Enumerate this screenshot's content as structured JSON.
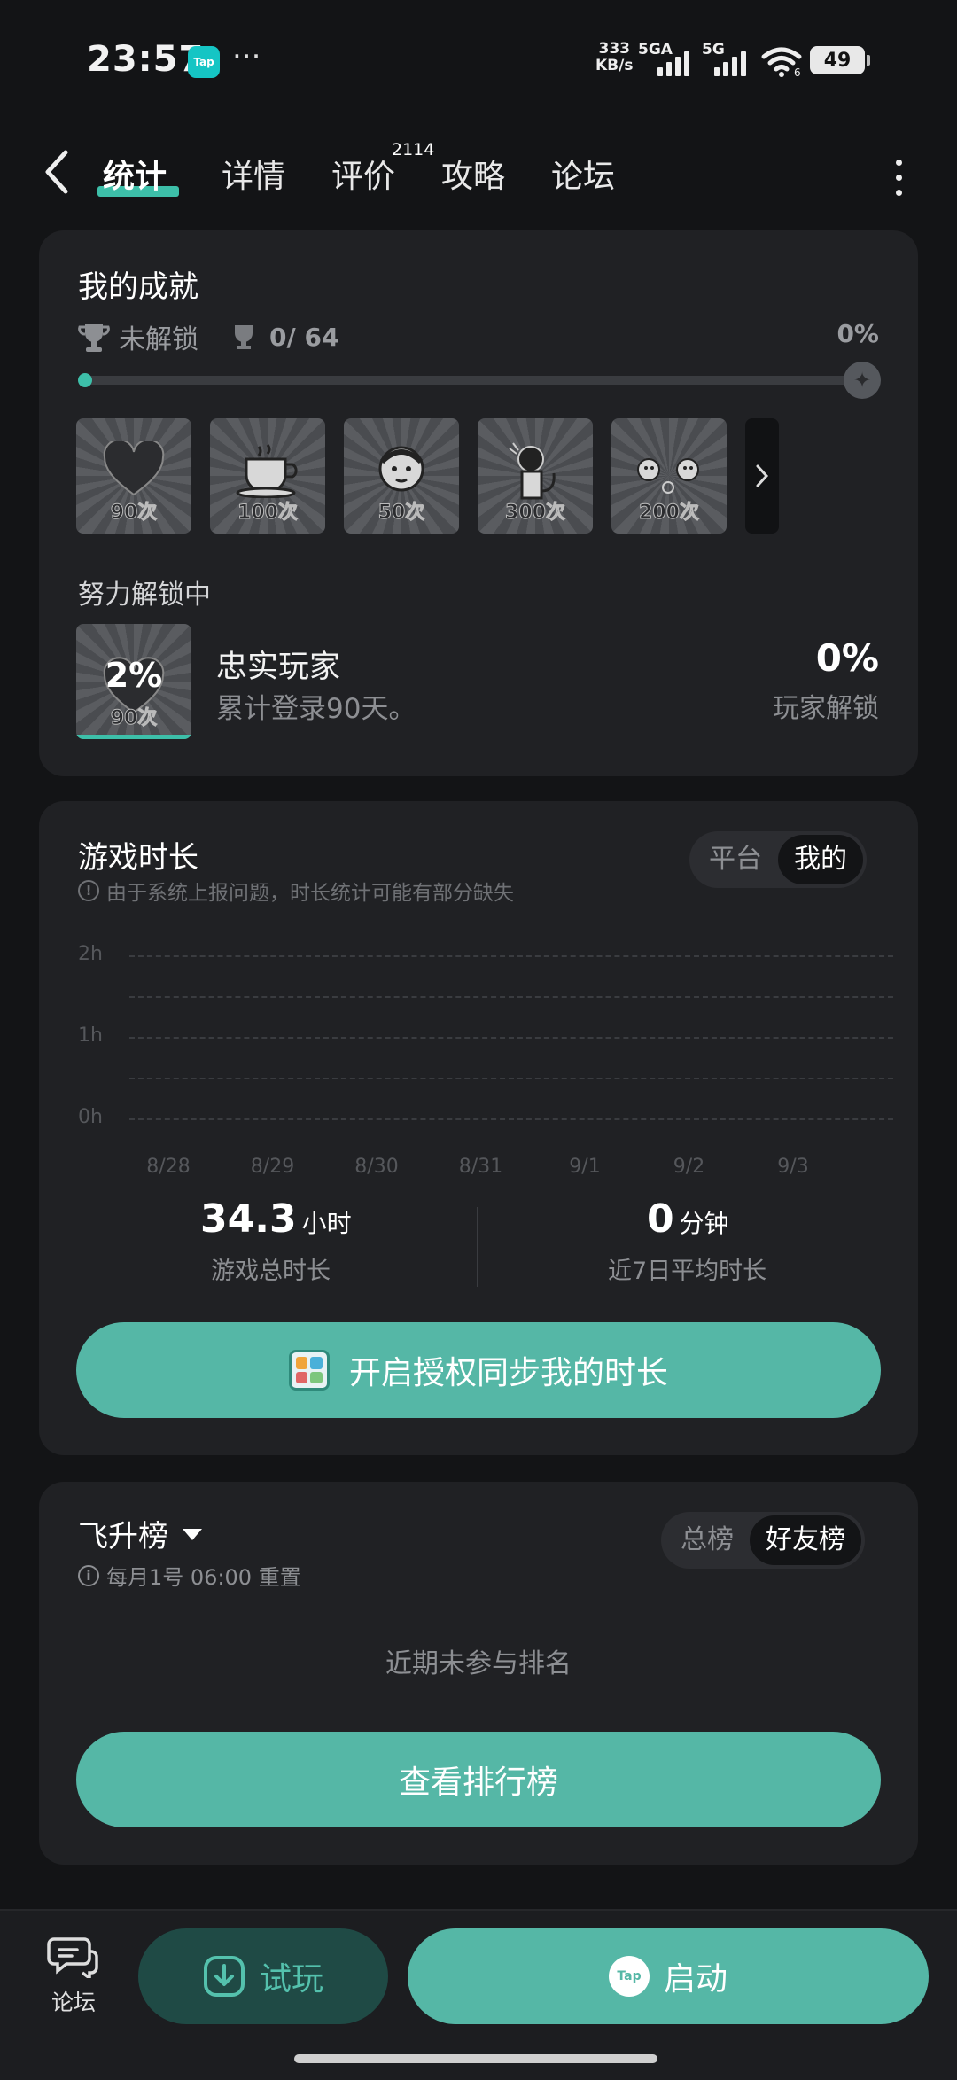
{
  "status": {
    "time": "23:57",
    "tap_badge": "Tap",
    "more_dots": "···",
    "net_speed_value": "333",
    "net_speed_unit": "KB/s",
    "sim1": "5GA",
    "sim2": "5G",
    "wifi_sub": "6",
    "battery": "49"
  },
  "nav": {
    "tabs": [
      {
        "label": "统计"
      },
      {
        "label": "详情"
      },
      {
        "label": "评价"
      },
      {
        "label": "攻略"
      },
      {
        "label": "论坛"
      }
    ],
    "review_count": "2114"
  },
  "achievements": {
    "title": "我的成就",
    "locked_label": "未解锁",
    "trophy_count": "0/ 64",
    "percent": "0%",
    "badges": [
      {
        "label": "90次",
        "icon": "heart-icon"
      },
      {
        "label": "100次",
        "icon": "coffee-icon"
      },
      {
        "label": "50次",
        "icon": "face-icon"
      },
      {
        "label": "300次",
        "icon": "cat-icon"
      },
      {
        "label": "200次",
        "icon": "chicks-icon"
      }
    ],
    "in_progress_title": "努力解锁中",
    "current": {
      "badge_percent": "2%",
      "badge_label": "90次",
      "name": "忠实玩家",
      "desc": "累计登录90天。",
      "percent": "0%",
      "percent_label": "玩家解锁"
    }
  },
  "playtime": {
    "title": "游戏时长",
    "toggle": [
      "平台",
      "我的"
    ],
    "note": "由于系统上报问题，时长统计可能有部分缺失",
    "total_value": "34.3",
    "total_unit": "小时",
    "total_label": "游戏总时长",
    "avg_value": "0",
    "avg_unit": "分钟",
    "avg_label": "近7日平均时长",
    "sync_button": "开启授权同步我的时长"
  },
  "chart_data": {
    "type": "bar",
    "categories": [
      "8/28",
      "8/29",
      "8/30",
      "8/31",
      "9/1",
      "9/2",
      "9/3"
    ],
    "values": [
      0,
      0,
      0,
      0,
      0,
      0,
      0
    ],
    "y_ticks": [
      "2h",
      "1h",
      "0h"
    ],
    "ylim": [
      0,
      2
    ],
    "grid": true
  },
  "ranking": {
    "title": "飞升榜",
    "toggle": [
      "总榜",
      "好友榜"
    ],
    "note": "每月1号 06:00 重置",
    "empty": "近期未参与排名",
    "button": "查看排行榜"
  },
  "bottom": {
    "forum": "论坛",
    "trial": "试玩",
    "launch": "启动",
    "tap_logo": "Tap"
  },
  "colors": {
    "accent": "#55b7a6",
    "background": "#131416",
    "card": "#202124"
  }
}
